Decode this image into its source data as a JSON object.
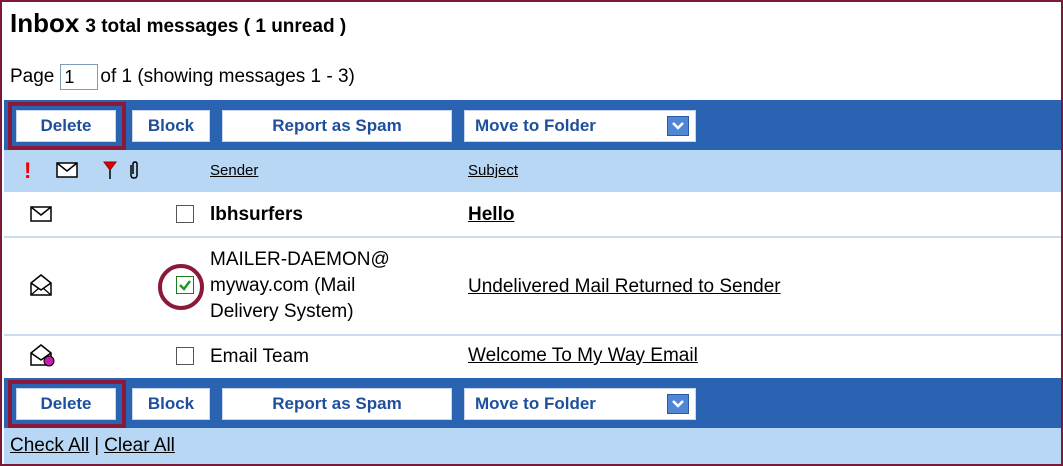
{
  "inbox": {
    "title": "Inbox",
    "summary": "3 total messages ( 1 unread )"
  },
  "pagination": {
    "page_label": "Page",
    "page_value": "1",
    "of_text": "of 1 (showing messages 1 - 3)"
  },
  "toolbar": {
    "delete_label": "Delete",
    "block_label": "Block",
    "spam_label": "Report as Spam",
    "move_label": "Move to Folder"
  },
  "columns": {
    "sender": "Sender",
    "subject": "Subject",
    "priority_symbol": "!"
  },
  "messages": [
    {
      "sender": "lbhsurfers",
      "subject": "Hello",
      "unread": true,
      "checked": false,
      "icon": "envelope-closed-icon"
    },
    {
      "sender_lines": [
        "MAILER-DAEMON@",
        "myway.com (Mail",
        "Delivery System)"
      ],
      "subject": "Undelivered Mail Returned to Sender",
      "unread": false,
      "checked": true,
      "icon": "envelope-open-icon"
    },
    {
      "sender": "Email Team",
      "subject": "Welcome To My Way Email",
      "unread": false,
      "checked": false,
      "icon": "envelope-open-replied-icon"
    }
  ],
  "footer": {
    "check_all": "Check All",
    "separator": "|",
    "clear_all": "Clear All"
  },
  "colors": {
    "toolbar": "#2b63b3",
    "header": "#b7d7f5",
    "annotation": "#8b1a3a",
    "button_text": "#1e4f9c"
  }
}
